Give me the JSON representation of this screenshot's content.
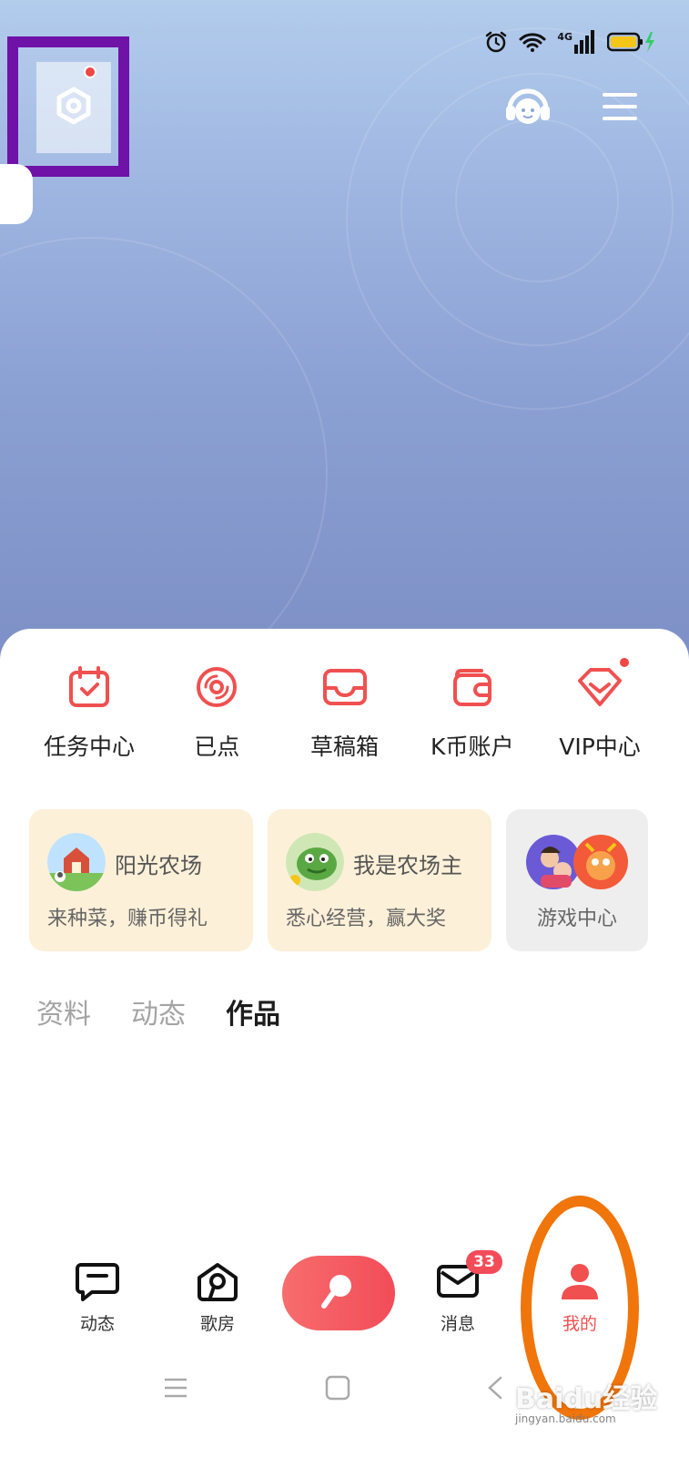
{
  "status_bar": {
    "icons": [
      "alarm-icon",
      "wifi-icon",
      "signal-4g-icon",
      "battery-charging-icon"
    ],
    "network_label": "4G"
  },
  "header": {
    "settings_icon": "settings-gear-icon",
    "settings_notification": true,
    "service_icon": "customer-service-icon",
    "menu_icon": "hamburger-menu-icon"
  },
  "quick_actions": [
    {
      "label": "任务中心",
      "icon": "calendar-check-icon",
      "dot": false
    },
    {
      "label": "已点",
      "icon": "disc-icon",
      "dot": false
    },
    {
      "label": "草稿箱",
      "icon": "inbox-tray-icon",
      "dot": false
    },
    {
      "label": "K币账户",
      "icon": "wallet-icon",
      "dot": false
    },
    {
      "label": "VIP中心",
      "icon": "diamond-icon",
      "dot": true
    }
  ],
  "promo_cards": [
    {
      "title": "阳光农场",
      "subtitle": "来种菜，赚币得礼",
      "icon": "farm-barn-icon"
    },
    {
      "title": "我是农场主",
      "subtitle": "悉心经营，赢大奖",
      "icon": "dinosaur-icon"
    },
    {
      "title": "",
      "subtitle": "游戏中心",
      "icon": "game-characters-icon"
    }
  ],
  "profile_tabs": [
    {
      "label": "资料",
      "active": false
    },
    {
      "label": "动态",
      "active": false
    },
    {
      "label": "作品",
      "active": true
    }
  ],
  "bottom_nav": {
    "items": [
      {
        "label": "动态",
        "icon": "chat-bubble-icon",
        "active": false
      },
      {
        "label": "歌房",
        "icon": "music-house-icon",
        "active": false
      },
      {
        "label": "消息",
        "icon": "mail-icon",
        "active": false
      },
      {
        "label": "我的",
        "icon": "user-icon",
        "active": true
      }
    ],
    "record_icon": "microphone-icon",
    "message_badge": "33"
  },
  "system_nav": [
    "menu-lines-icon",
    "home-square-icon",
    "back-arrow-icon"
  ],
  "watermark": {
    "brand": "Baidu经验",
    "url": "jingyan.baidu.com"
  },
  "colors": {
    "accent": "#f24c58",
    "card_warm": "#fdf0d8",
    "card_gray": "#eeeeee",
    "annotation_purple": "#6f12a8",
    "annotation_orange": "#f0750a"
  }
}
